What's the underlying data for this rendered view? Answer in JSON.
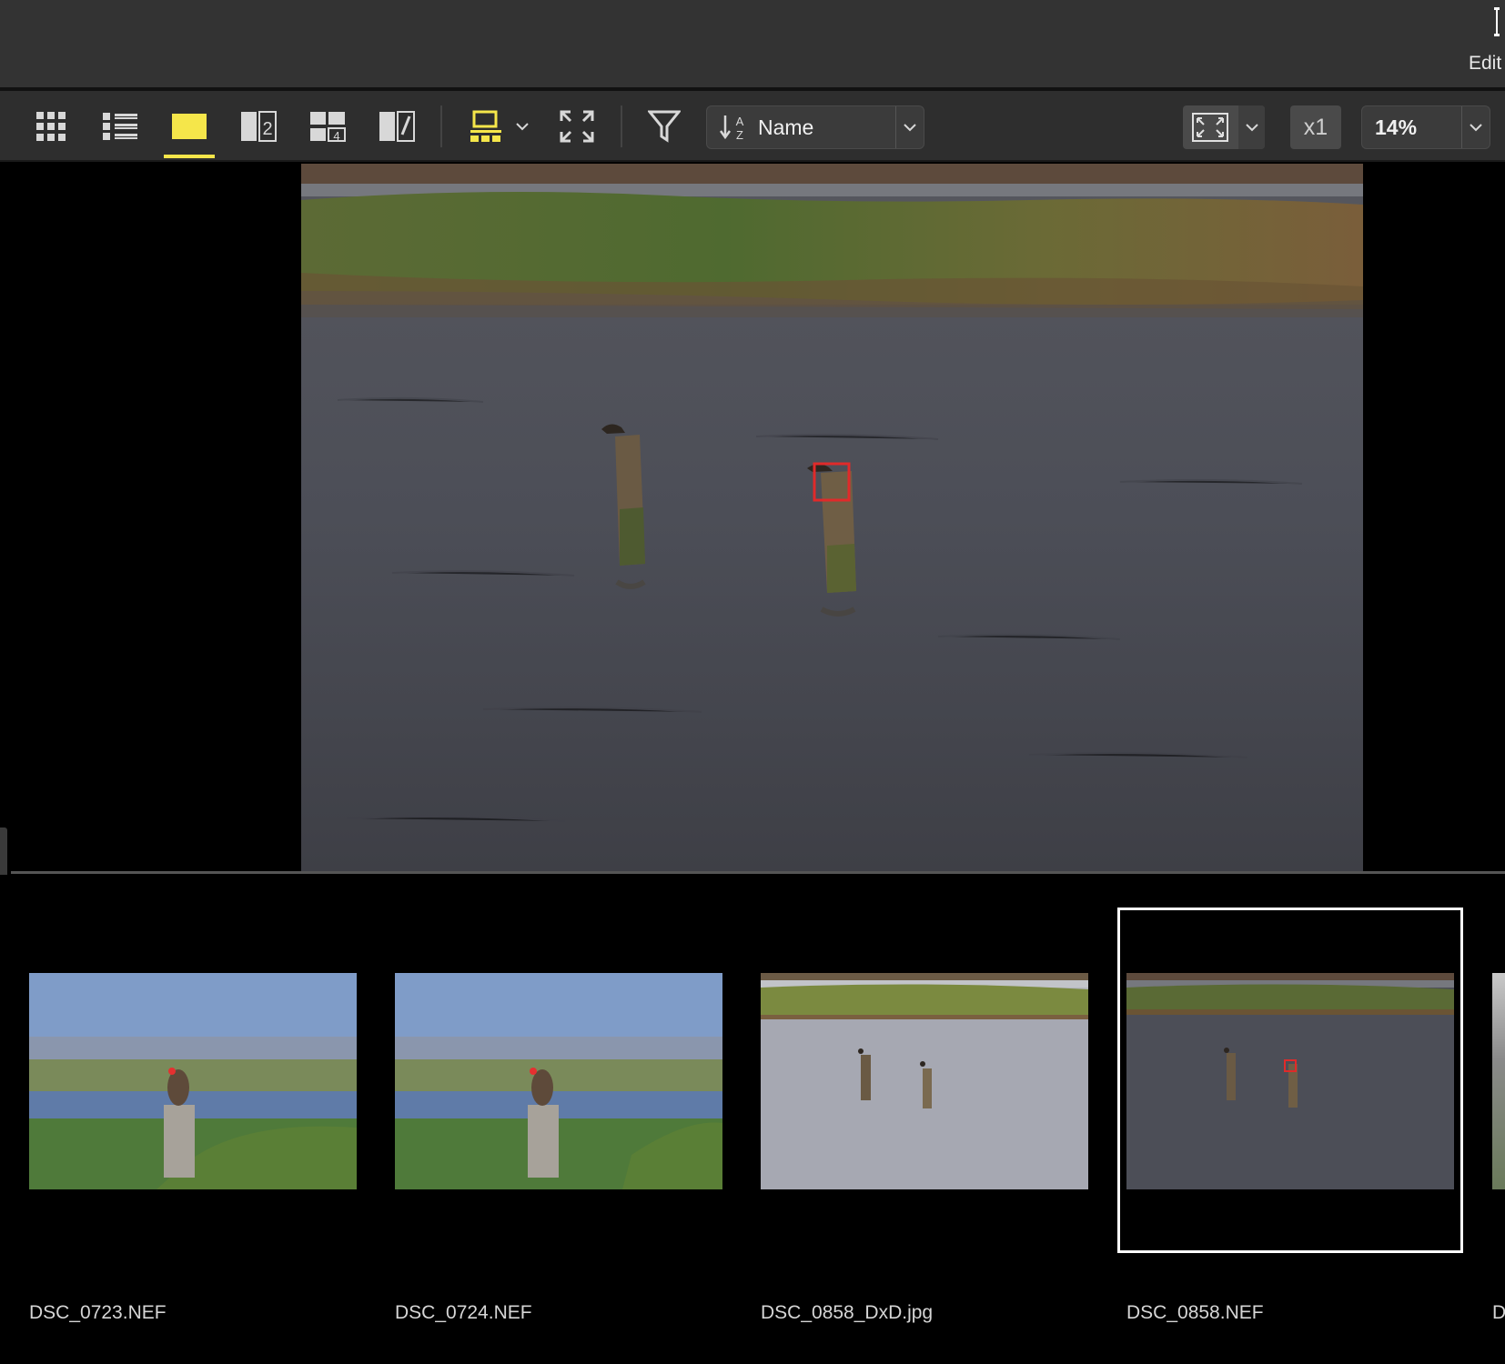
{
  "topbar": {
    "edit_label": "Edit"
  },
  "toolbar": {
    "view_modes": [
      {
        "name": "grid-view",
        "icon": "grid-icon"
      },
      {
        "name": "list-view",
        "icon": "list-icon"
      },
      {
        "name": "single-view",
        "icon": "single-image-icon",
        "active": true
      },
      {
        "name": "compare-2-view",
        "icon": "compare-two-icon",
        "badge": "2"
      },
      {
        "name": "compare-4-view",
        "icon": "compare-four-icon",
        "badge": "4"
      },
      {
        "name": "split-view",
        "icon": "split-view-icon"
      }
    ],
    "sort": {
      "label": "Name",
      "icon": "sort-az-icon"
    },
    "scale_label": "x1",
    "zoom_label": "14%",
    "accent_color": "#f5e64a"
  },
  "filmstrip": {
    "items": [
      {
        "filename": "DSC_0723.NEF"
      },
      {
        "filename": "DSC_0724.NEF"
      },
      {
        "filename": "DSC_0858_DxD.jpg"
      },
      {
        "filename": "DSC_0858.NEF",
        "selected": true
      }
    ],
    "partial_label": "D"
  }
}
